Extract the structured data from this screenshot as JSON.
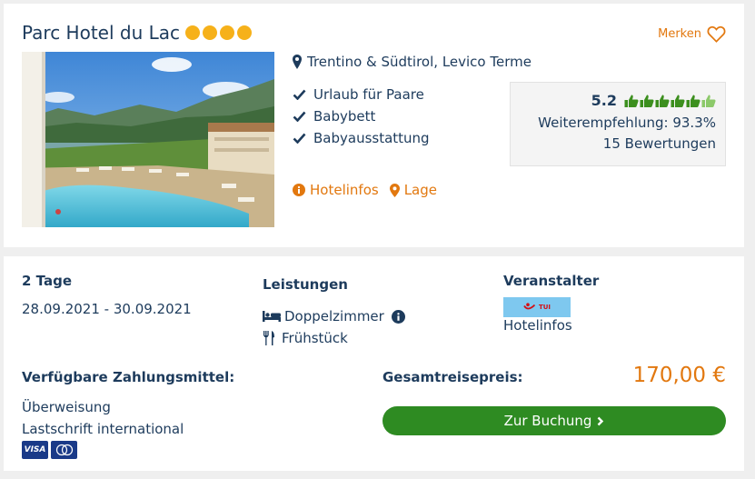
{
  "hotel": {
    "name": "Parc Hotel du Lac",
    "star_count": 4,
    "merken_label": "Merken",
    "location": "Trentino & Südtirol, Levico Terme",
    "features": [
      "Urlaub für Paare",
      "Babybett",
      "Babyausstattung"
    ],
    "link_hotelinfos": "Hotelinfos",
    "link_lage": "Lage"
  },
  "rating": {
    "score": "5.2",
    "thumbs_of": 6,
    "recommendation": "Weiterempfehlung: 93.3%",
    "reviews": "15 Bewertungen"
  },
  "offer": {
    "duration": "2 Tage",
    "dates": "28.09.2021 - 30.09.2021",
    "services_heading": "Leistungen",
    "room": "Doppelzimmer",
    "board": "Frühstück",
    "operator_heading": "Veranstalter",
    "operator_logo_text": "TUI",
    "operator_link": "Hotelinfos",
    "payment_heading": "Verfügbare Zahlungsmittel:",
    "payment_methods": [
      "Überweisung",
      "Lastschrift international"
    ],
    "card_visa": "VISA",
    "total_label": "Gesamtreisepreis:",
    "price": "170,00 €",
    "book_label": "Zur Buchung"
  },
  "colors": {
    "primary_text": "#1d3b5c",
    "accent_orange": "#e2780f",
    "star_yellow": "#f6b11a",
    "button_green": "#2e8b22",
    "thumb_green": "#3c8f1e"
  }
}
